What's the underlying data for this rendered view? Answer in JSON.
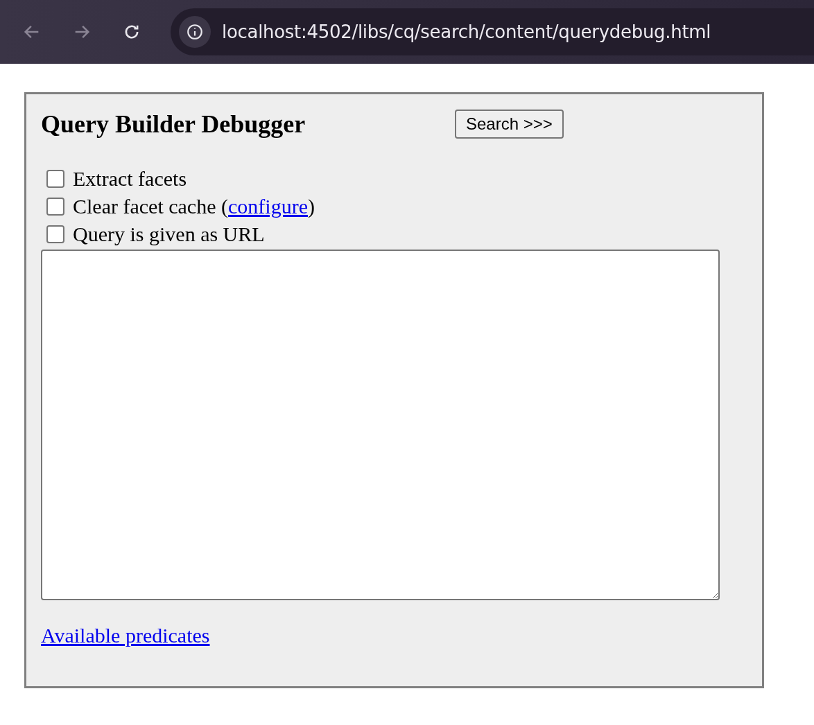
{
  "browser": {
    "nav_buttons": [
      {
        "kind": "back",
        "disabled": true
      },
      {
        "kind": "forward",
        "disabled": true
      },
      {
        "kind": "reload",
        "disabled": false
      }
    ],
    "url": "localhost:4502/libs/cq/search/content/querydebug.html"
  },
  "page": {
    "title": "Query Builder Debugger",
    "search_button": "Search >>>",
    "options": [
      {
        "before": "Extract facets",
        "checked": false
      },
      {
        "before": "Clear facet cache (",
        "link": "configure",
        "after": ")",
        "checked": false
      },
      {
        "before": "Query is given as URL",
        "checked": false
      }
    ],
    "footer_link": "Available predicates"
  }
}
